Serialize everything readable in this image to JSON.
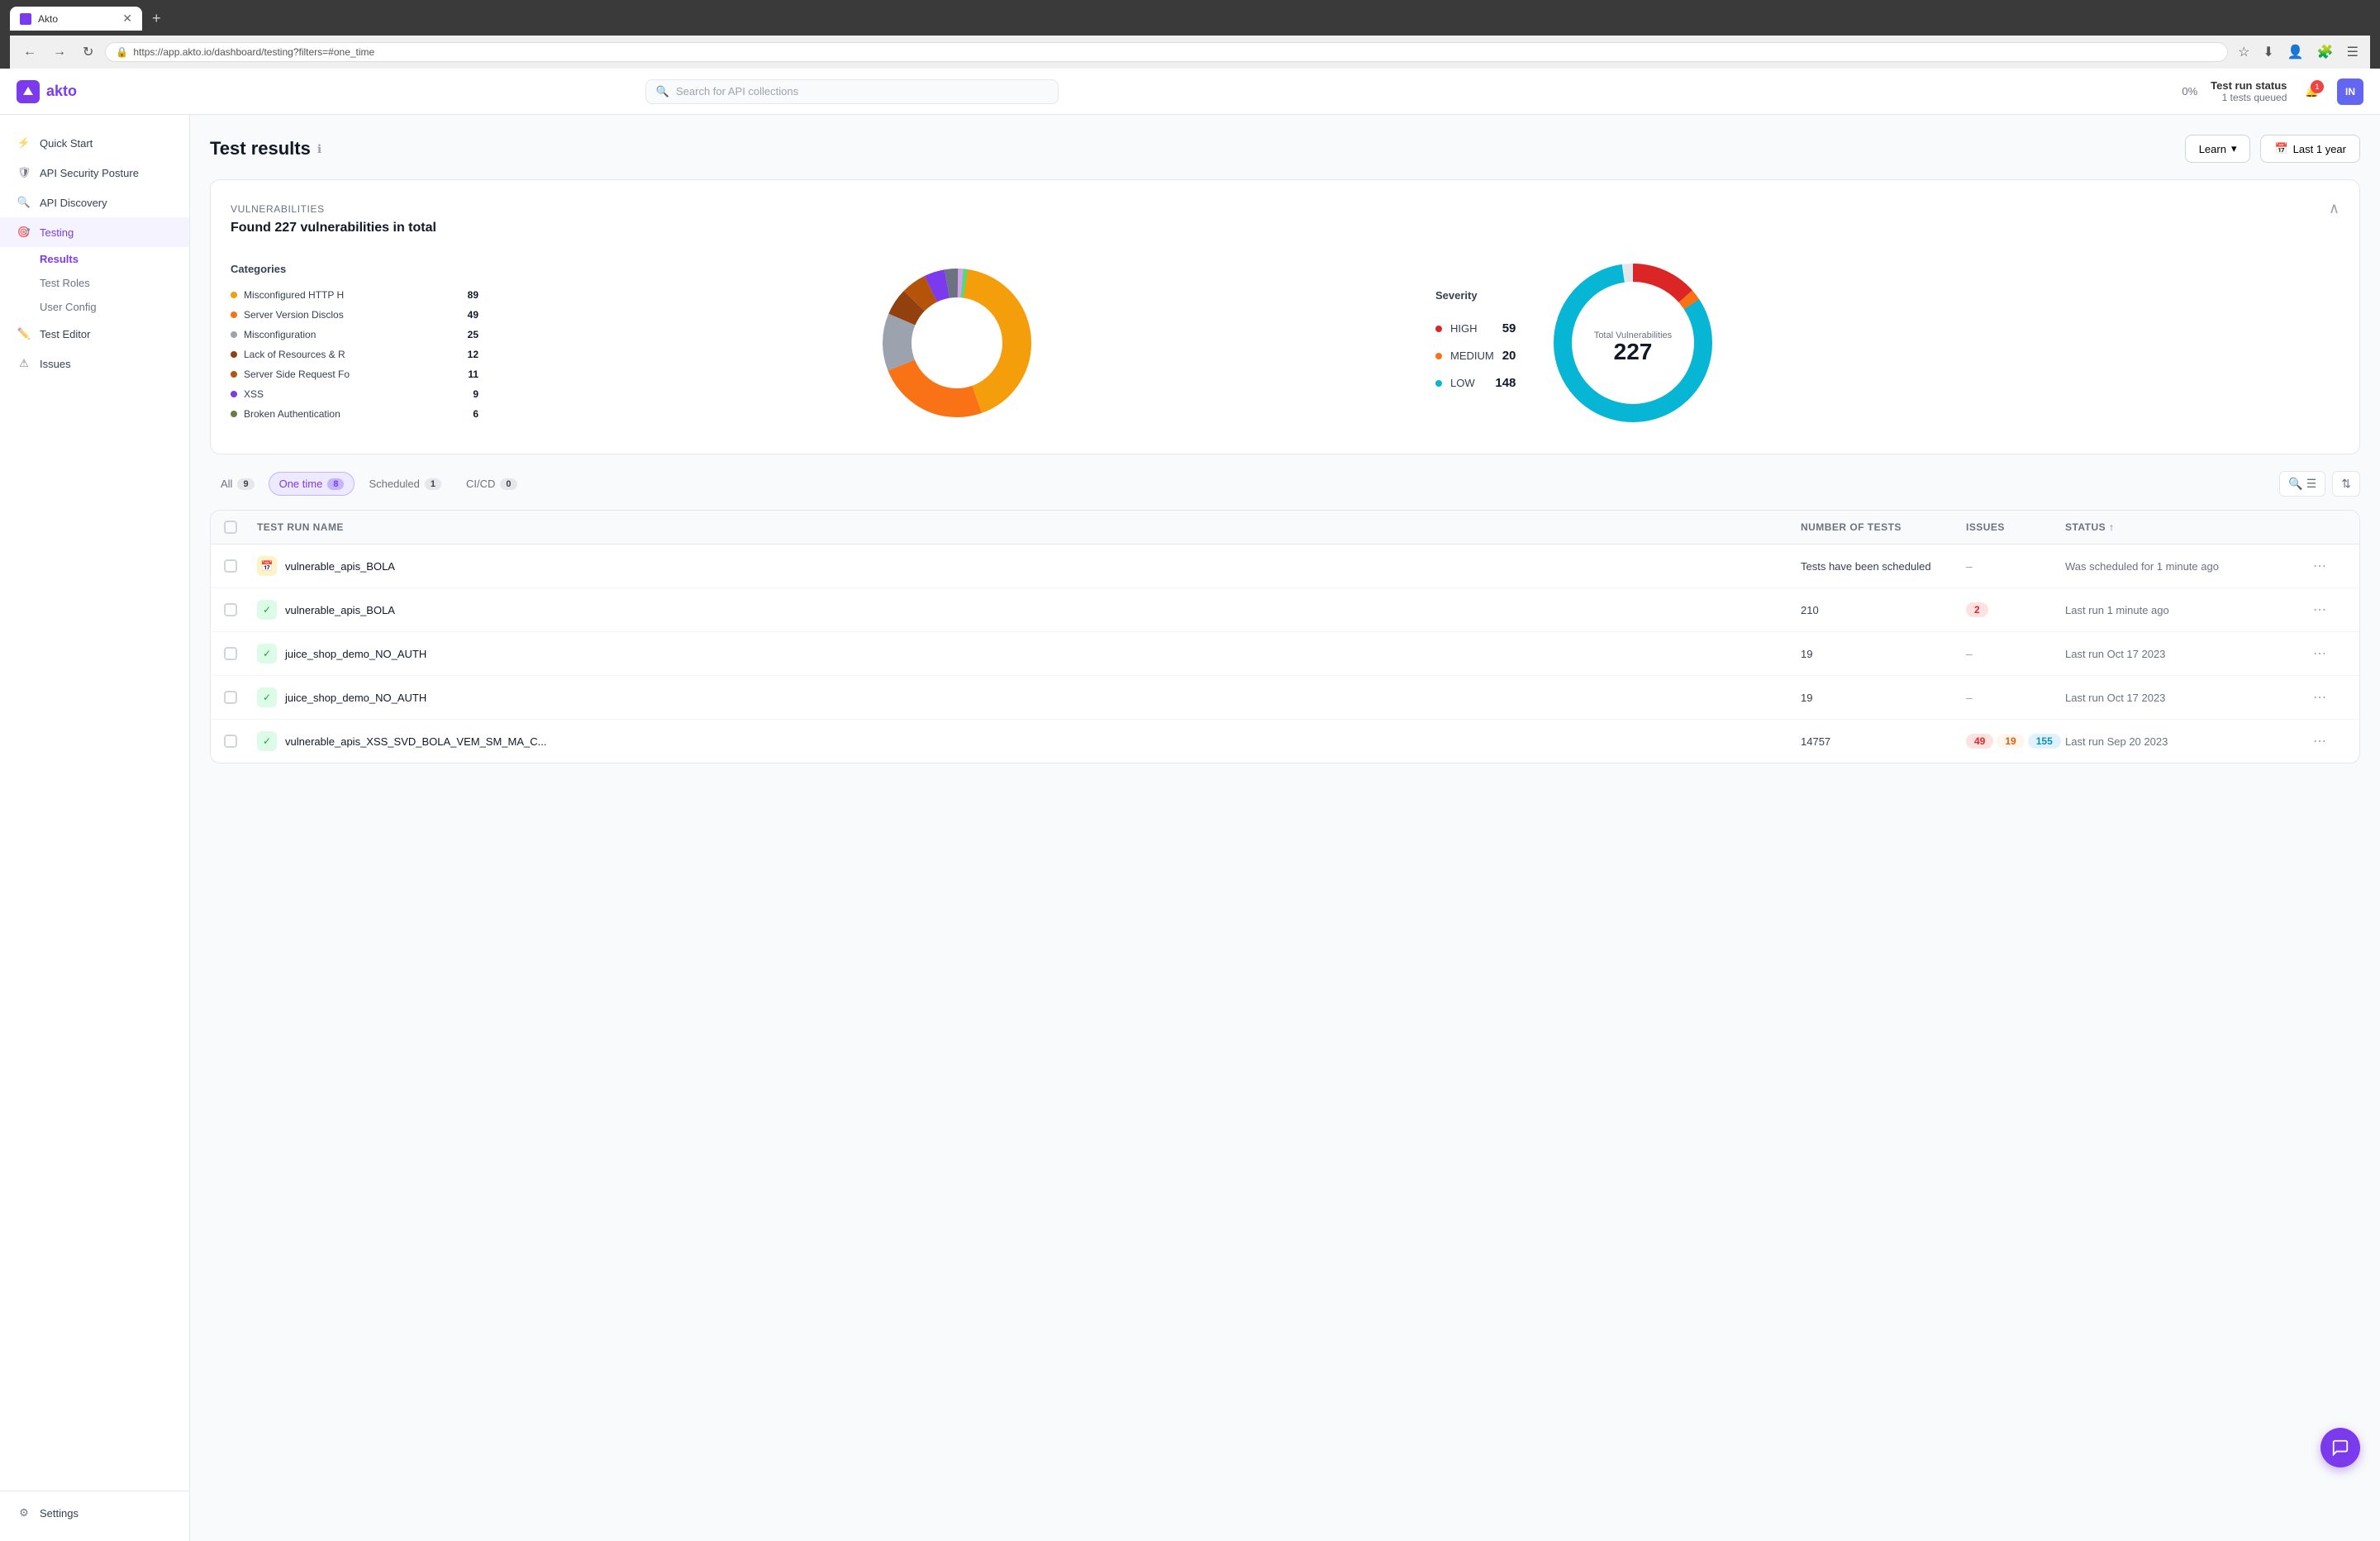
{
  "browser": {
    "tab_title": "Akto",
    "url": "https://app.akto.io/dashboard/testing?filters=#one_time",
    "new_tab_label": "+",
    "back_label": "←",
    "forward_label": "→",
    "refresh_label": "↻"
  },
  "topbar": {
    "logo_text": "akto",
    "search_placeholder": "Search for API collections",
    "progress_label": "0%",
    "test_run_status_title": "Test run status",
    "test_run_status_subtitle": "1 tests queued",
    "notification_count": "1",
    "avatar_label": "IN"
  },
  "sidebar": {
    "items": [
      {
        "id": "quick-start",
        "label": "Quick Start",
        "icon": "⚡"
      },
      {
        "id": "api-security-posture",
        "label": "API Security Posture",
        "icon": "🛡"
      },
      {
        "id": "api-discovery",
        "label": "API Discovery",
        "icon": "🔍"
      },
      {
        "id": "testing",
        "label": "Testing",
        "icon": "🎯",
        "active": true
      },
      {
        "id": "test-editor",
        "label": "Test Editor",
        "icon": "✏️"
      },
      {
        "id": "issues",
        "label": "Issues",
        "icon": "⚠"
      }
    ],
    "sub_items": [
      {
        "id": "results",
        "label": "Results",
        "active": true
      },
      {
        "id": "test-roles",
        "label": "Test Roles"
      },
      {
        "id": "user-config",
        "label": "User Config"
      }
    ],
    "settings_label": "Settings"
  },
  "page": {
    "title": "Test results",
    "learn_button": "Learn",
    "date_range_button": "Last 1 year"
  },
  "vulnerabilities": {
    "section_label": "Vulnerabilities",
    "total_text": "Found 227 vulnerabilities in total",
    "categories_title": "Categories",
    "categories": [
      {
        "name": "Misconfigured HTTP H",
        "count": 89,
        "color": "#f59e0b"
      },
      {
        "name": "Server Version Disclos",
        "count": 49,
        "color": "#f97316"
      },
      {
        "name": "Misconfiguration",
        "count": 25,
        "color": "#9ca3af"
      },
      {
        "name": "Lack of Resources & R",
        "count": 12,
        "color": "#92400e"
      },
      {
        "name": "Server Side Request Fo",
        "count": 11,
        "color": "#b45309"
      },
      {
        "name": "XSS",
        "count": 9,
        "color": "#7c3aed"
      },
      {
        "name": "Broken Authentication",
        "count": 6,
        "color": "#6d7c47"
      }
    ],
    "severity_title": "Severity",
    "severity": [
      {
        "label": "HIGH",
        "count": 59,
        "color": "#dc2626"
      },
      {
        "label": "MEDIUM",
        "count": 20,
        "color": "#f97316"
      },
      {
        "label": "LOW",
        "count": 148,
        "color": "#06b6d4"
      }
    ],
    "total_number": "227",
    "total_label": "Total Vulnerabilities"
  },
  "filter_tabs": [
    {
      "id": "all",
      "label": "All",
      "count": 9,
      "active": false
    },
    {
      "id": "one-time",
      "label": "One time",
      "count": 8,
      "active": true
    },
    {
      "id": "scheduled",
      "label": "Scheduled",
      "count": 1,
      "active": false
    },
    {
      "id": "ci-cd",
      "label": "CI/CD",
      "count": 0,
      "active": false
    }
  ],
  "table": {
    "columns": [
      "",
      "Test run name",
      "Number of tests",
      "Issues",
      "Status",
      ""
    ],
    "rows": [
      {
        "icon_type": "calendar",
        "name": "vulnerable_apis_BOLA",
        "tests": "Tests have been scheduled",
        "issues": null,
        "status": "Was scheduled for 1 minute ago"
      },
      {
        "icon_type": "check",
        "name": "vulnerable_apis_BOLA",
        "tests": "210",
        "issues": [
          {
            "count": 2,
            "class": "badge-red"
          }
        ],
        "status": "Last run 1 minute ago"
      },
      {
        "icon_type": "check",
        "name": "juice_shop_demo_NO_AUTH",
        "tests": "19",
        "issues": null,
        "status": "Last run Oct 17 2023"
      },
      {
        "icon_type": "check",
        "name": "juice_shop_demo_NO_AUTH",
        "tests": "19",
        "issues": null,
        "status": "Last run Oct 17 2023"
      },
      {
        "icon_type": "check",
        "name": "vulnerable_apis_XSS_SVD_BOLA_VEM_SM_MA_C...",
        "tests": "14757",
        "issues": [
          {
            "count": 49,
            "class": "badge-red"
          },
          {
            "count": 19,
            "class": "badge-orange"
          },
          {
            "count": 155,
            "class": "badge-teal"
          }
        ],
        "status": "Last run Sep 20 2023"
      }
    ]
  }
}
